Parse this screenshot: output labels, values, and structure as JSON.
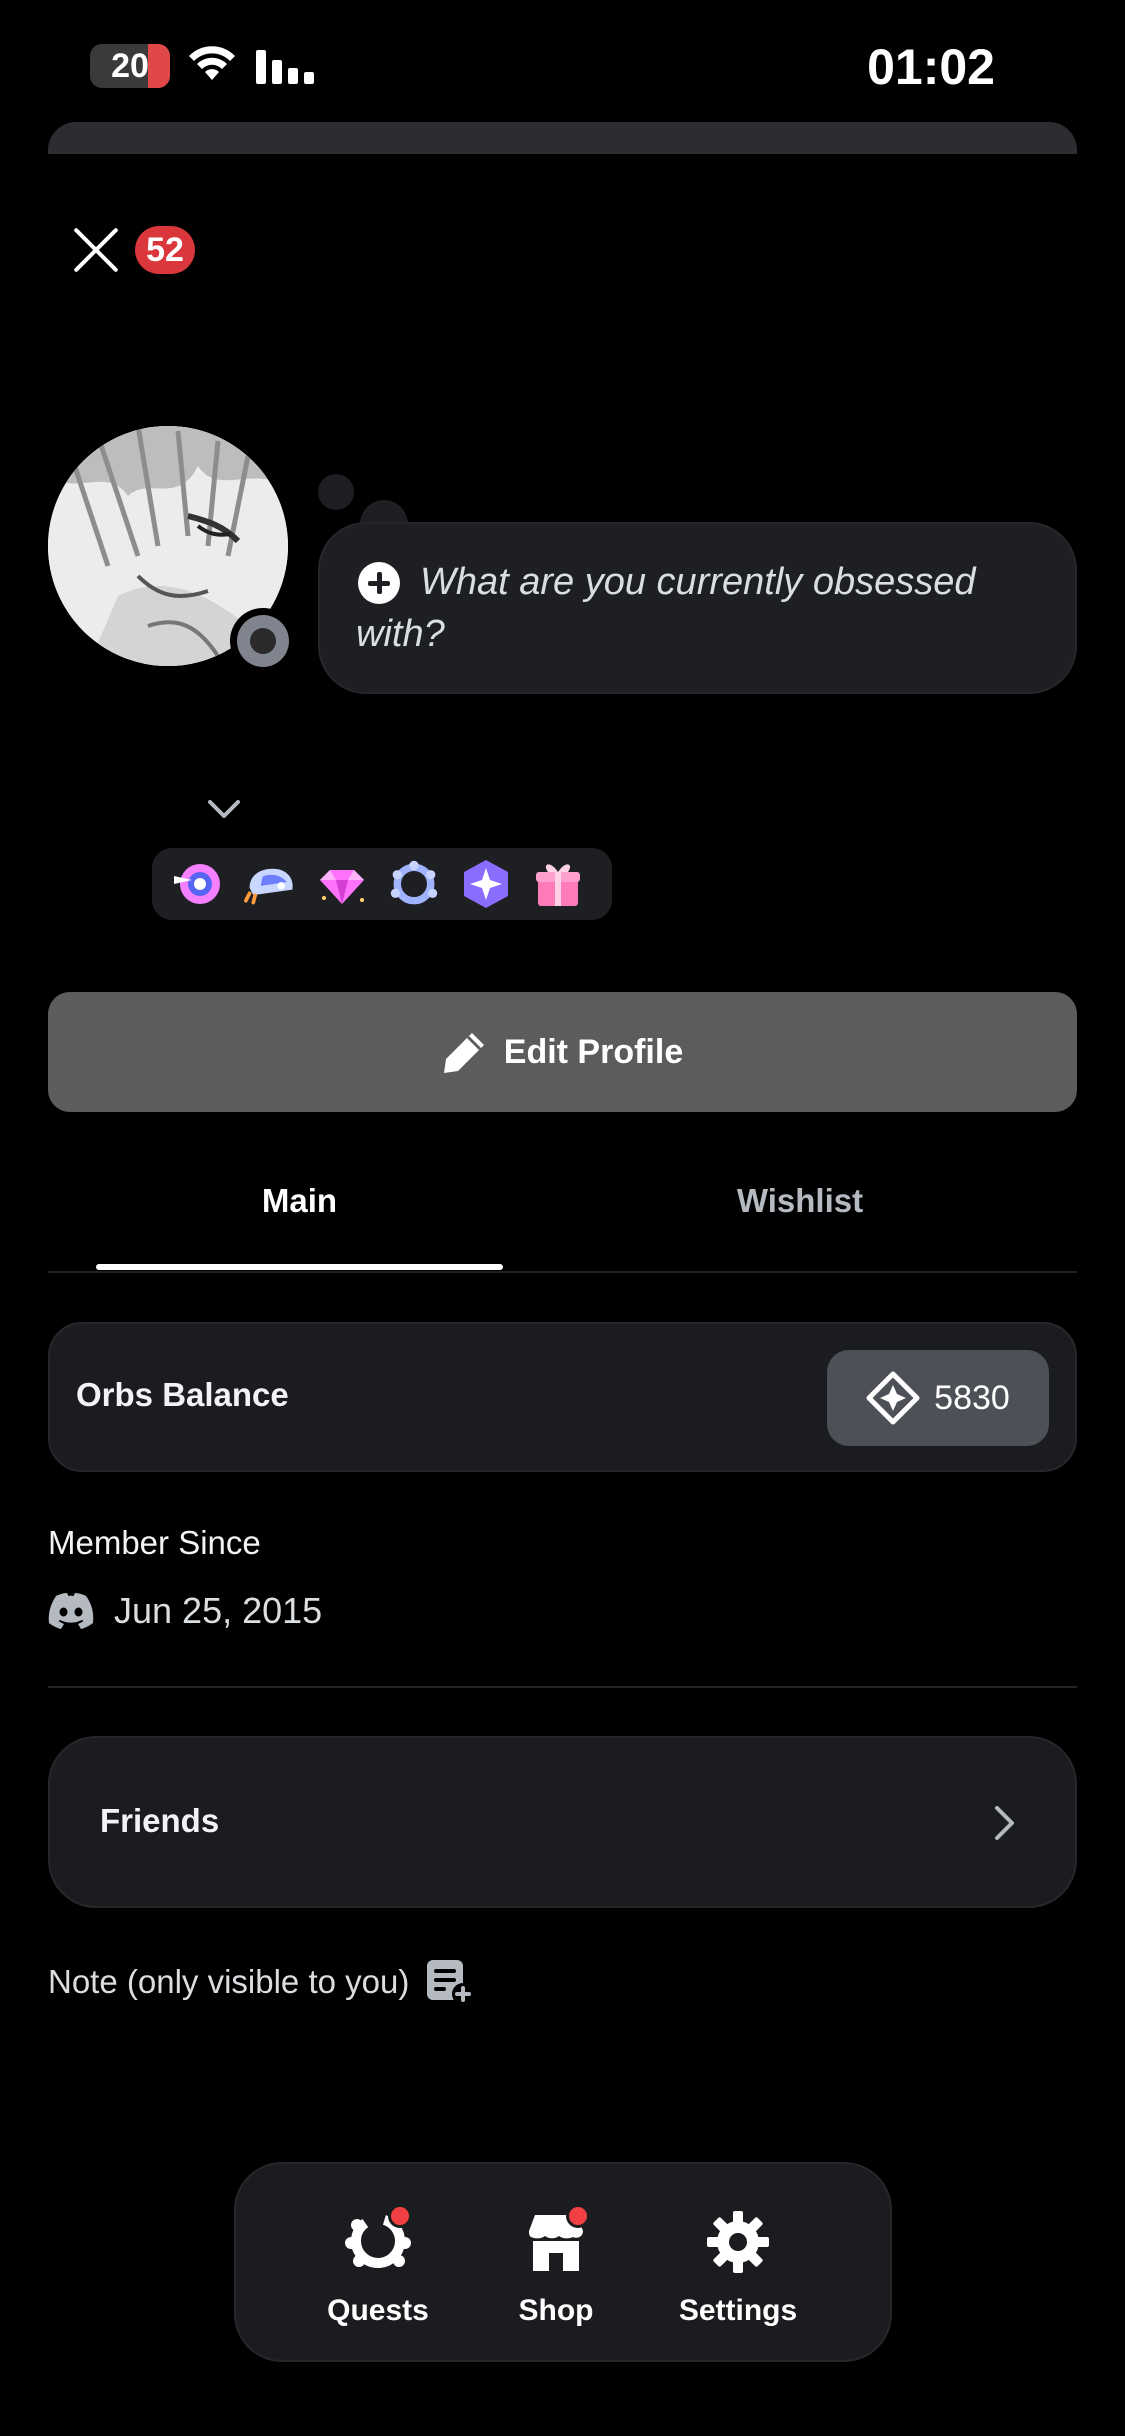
{
  "status_bar": {
    "battery": "20",
    "time": "01:02"
  },
  "header": {
    "notification_count": "52"
  },
  "profile": {
    "status_prompt": "What are you currently obsessed with?",
    "badges": [
      "hypesquad-icon",
      "nitro-icon",
      "gem-icon",
      "laurel-icon",
      "orb-badge-icon",
      "gift-icon"
    ],
    "edit_button": "Edit Profile"
  },
  "tabs": {
    "main": "Main",
    "wishlist": "Wishlist"
  },
  "orbs": {
    "label": "Orbs Balance",
    "value": "5830"
  },
  "member": {
    "title": "Member Since",
    "date": "Jun 25, 2015"
  },
  "friends": {
    "label": "Friends"
  },
  "note": {
    "label": "Note (only visible to you)"
  },
  "bottom_nav": {
    "quests": "Quests",
    "shop": "Shop",
    "settings": "Settings"
  },
  "colors": {
    "background": "#000000",
    "card": "#1b1c1f",
    "button": "#5c5c5c",
    "badge_red": "#da373c"
  }
}
